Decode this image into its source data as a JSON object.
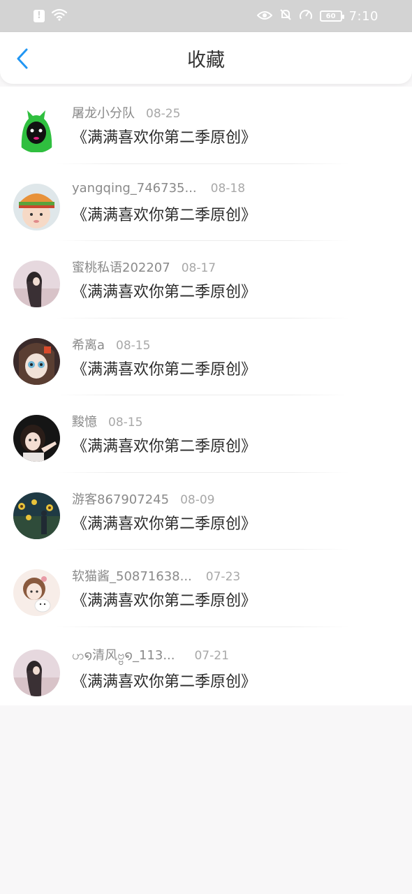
{
  "status_bar": {
    "alert_icon": "alert-icon",
    "wifi_icon": "wifi-icon",
    "eye_icon": "eye-comfort-icon",
    "mute_icon": "bell-muted-icon",
    "speed_icon": "speed-icon",
    "battery_level": "60",
    "time": "7:10"
  },
  "header": {
    "title": "收藏",
    "back_icon": "chevron-left-icon",
    "accent_color": "#2196f3"
  },
  "items": [
    {
      "name": "屠龙小分队",
      "date": "08-25",
      "content": "《满满喜欢你第二季原创》",
      "avatar": "green-hood-avatar"
    },
    {
      "name": "yangqing_746735...",
      "date": "08-18",
      "content": "《满满喜欢你第二季原创》",
      "avatar": "baby-burger-hat-avatar"
    },
    {
      "name": "蜜桃私语202207",
      "date": "08-17",
      "content": "《满满喜欢你第二季原创》",
      "avatar": "girl-field-avatar"
    },
    {
      "name": "希离a",
      "date": "08-15",
      "content": "《满满喜欢你第二季原创》",
      "avatar": "anime-girl-avatar"
    },
    {
      "name": "黢憶",
      "date": "08-15",
      "content": "《满满喜欢你第二季原创》",
      "avatar": "girl-pointing-avatar"
    },
    {
      "name": "游客867907245",
      "date": "08-09",
      "content": "《满满喜欢你第二季原创》",
      "avatar": "sunflower-night-avatar"
    },
    {
      "name": "软猫酱_50871638...",
      "date": "07-23",
      "content": "《满满喜欢你第二季原创》",
      "avatar": "girl-cat-avatar"
    },
    {
      "name": "ဟ໑清风ဗ္ဗ໑_113...",
      "date": "07-21",
      "content": "《满满喜欢你第二季原创》",
      "avatar": "girl-field-avatar-2"
    }
  ]
}
